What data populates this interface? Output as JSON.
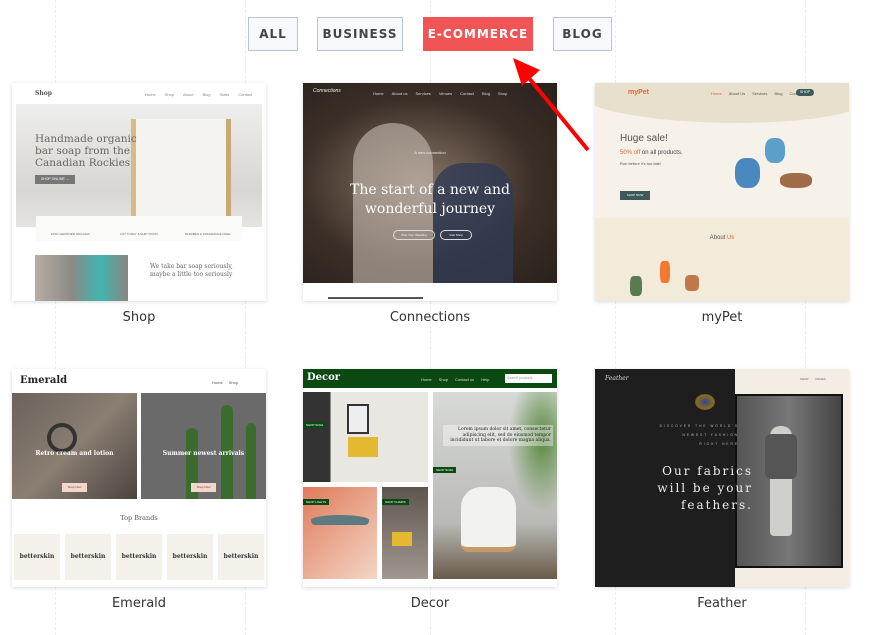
{
  "filters": [
    {
      "label": "ALL",
      "active": false
    },
    {
      "label": "BUSINESS",
      "active": false
    },
    {
      "label": "E-COMMERCE",
      "active": true
    },
    {
      "label": "BLOG",
      "active": false
    }
  ],
  "accent": "#f05454",
  "annotation": {
    "arrow_color": "#ff0000"
  },
  "templates": [
    {
      "name": "Shop",
      "thumb": {
        "logo": "Shop",
        "nav": [
          "Home",
          "Shop",
          "About",
          "Blog",
          "Stalls",
          "Contact"
        ],
        "hero": "Handmade organic bar soap from the Canadian Rockies",
        "cta": "SHOP ONLINE →",
        "features": [
          "100% CERTIFIED ORGANIC",
          "CUT TODAY & SHIP TODAY",
          "PARABEN & FRAGRANCE FREE"
        ],
        "subhead": "We take bar soap seriously, maybe a little too seriously"
      }
    },
    {
      "name": "Connections",
      "thumb": {
        "logo": "Connections",
        "nav": [
          "Home",
          "About us",
          "Services",
          "Venues",
          "Contact",
          "Blog",
          "Shop"
        ],
        "kicker": "A new connection",
        "hero": "The start of a new and wonderful journey",
        "buttons": [
          "Plan Your Wedding",
          "Visit Shop"
        ]
      }
    },
    {
      "name": "myPet",
      "thumb": {
        "logo": "myPet",
        "nav": [
          "Home",
          "About Us",
          "Services",
          "Blog",
          "Contact"
        ],
        "shop": "SHOP",
        "hero": "Huge sale!",
        "offer_pct": "50% off",
        "offer_rest": " on all products.",
        "sub": "Run before it's too late!",
        "cta": "SHOP NOW",
        "about": "About",
        "about_accent": "Us"
      }
    },
    {
      "name": "Emerald",
      "thumb": {
        "logo": "Emerald",
        "nav": [
          "Home",
          "Shop"
        ],
        "banners": [
          {
            "title": "Retro cream and lotion",
            "cta": "Shop Now"
          },
          {
            "title": "Summer newest arrivals",
            "cta": "Shop Now"
          }
        ],
        "brands_title": "Top Brands",
        "brand": "betterskin"
      }
    },
    {
      "name": "Decor",
      "thumb": {
        "logo": "Decor",
        "nav": [
          "Home",
          "Shop",
          "Contact us",
          "Help"
        ],
        "search_placeholder": "Search products",
        "tags": [
          "SHOP SOFA",
          "SHOP LIGHTS",
          "SHOP CHAIRS",
          "SHOP SOFA"
        ],
        "quote": "Lorem ipsum dolor sit amet, consectetur adipiscing elit, sed do eiusmod tempor incididunt ut labore et dolore magna aliqua."
      }
    },
    {
      "name": "Feather",
      "thumb": {
        "logo": "Feather",
        "nav": [
          "SHOP",
          "PAGES"
        ],
        "kicker": [
          "DISCOVER THE WORLD'S",
          "NEWEST FASHION",
          "RIGHT HERE"
        ],
        "hero": "Our fabrics will be your feathers."
      }
    }
  ]
}
